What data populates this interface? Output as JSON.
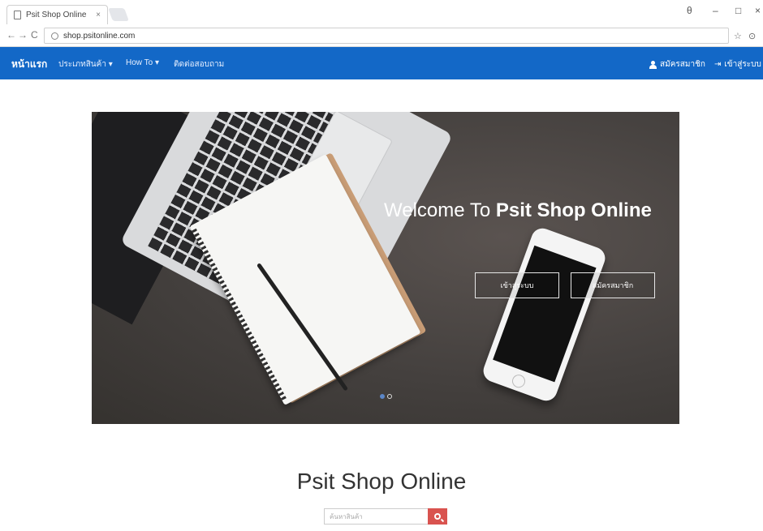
{
  "browser": {
    "tab_title": "Psit Shop Online",
    "tab_close": "×",
    "url": "shop.psitonline.com",
    "back": "←",
    "forward": "→",
    "reload": "C",
    "profile": "θ",
    "minimize": "–",
    "restore": "□",
    "close": "×",
    "star": "☆",
    "menu": "⊙"
  },
  "navbar": {
    "brand": "หน้าแรก",
    "items": [
      "ประเภทสินค้า ▾",
      "How To ▾",
      "ติดต่อสอบถาม"
    ],
    "register": "สมัครสมาชิก",
    "login": "เข้าสู่ระบบ",
    "login_glyph": "⇥",
    "color": "#1368c7"
  },
  "hero": {
    "welcome_prefix": "Welcome To ",
    "welcome_bold": "Psit Shop Online",
    "btn_login": "เข้าสู่ระบบ",
    "btn_register": "สมัครสมาชิก",
    "slides_total": 2,
    "active_slide": 1
  },
  "site_title": "Psit Shop Online",
  "search": {
    "placeholder": "ค้นหาสินค้า",
    "button_color": "#d9534f"
  }
}
